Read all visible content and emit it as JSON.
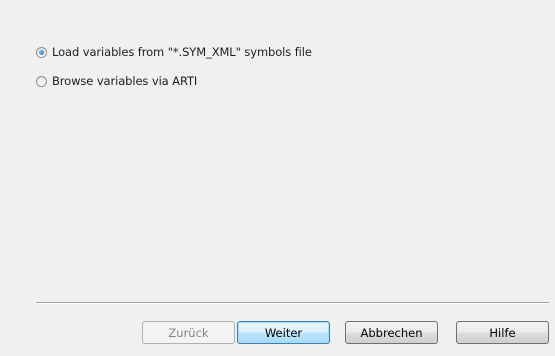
{
  "options": [
    {
      "label": "Load variables from \"*.SYM_XML\" symbols file",
      "checked": true
    },
    {
      "label": "Browse variables via ARTI",
      "checked": false
    }
  ],
  "buttons": {
    "back": "Zurück",
    "next": "Weiter",
    "cancel": "Abbrechen",
    "help": "Hilfe"
  }
}
